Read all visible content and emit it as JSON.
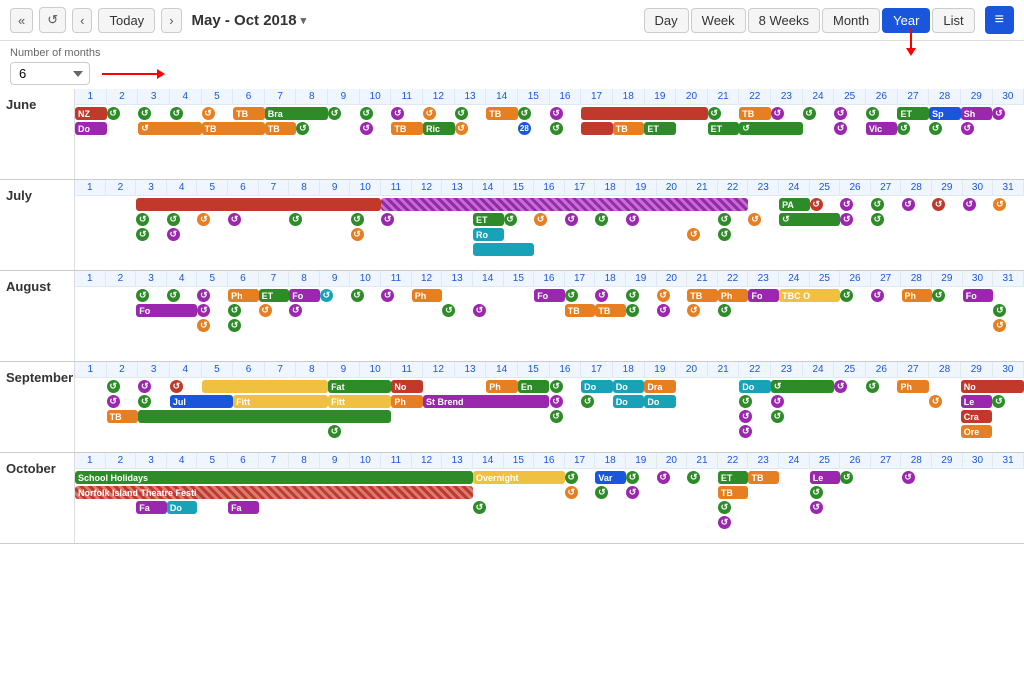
{
  "toolbar": {
    "back_back_label": "«",
    "refresh_label": "↺",
    "back_label": "‹",
    "today_label": "Today",
    "forward_label": "›",
    "date_range": "May - Oct 2018",
    "chevron": "∨",
    "views": [
      "Day",
      "Week",
      "8 Weeks",
      "Month",
      "Year",
      "List"
    ],
    "active_view": "Year",
    "menu_label": "≡"
  },
  "controls": {
    "months_label": "Number of months",
    "months_value": "6"
  },
  "months": [
    {
      "name": "June",
      "days": 30,
      "start_offset": 0
    },
    {
      "name": "July",
      "days": 31,
      "start_offset": 0
    },
    {
      "name": "August",
      "days": 31,
      "start_offset": 0
    },
    {
      "name": "September",
      "days": 30,
      "start_offset": 0
    },
    {
      "name": "October",
      "days": 31,
      "start_offset": 0
    }
  ],
  "june_events": [
    {
      "label": "NZ",
      "color": "#c0392b",
      "col_start": 1,
      "col_span": 1
    },
    {
      "label": "Br",
      "color": "#2d8c27",
      "col_start": 3,
      "col_span": 2
    },
    {
      "label": "TB",
      "color": "#e67e22",
      "col_start": 6,
      "col_span": 1
    },
    {
      "label": "Do",
      "color": "#9b27af",
      "col_start": 1,
      "col_span": 1
    },
    {
      "label": "TB",
      "color": "#e67e22",
      "col_start": 7,
      "col_span": 2
    },
    {
      "label": "",
      "color": "#c0392b",
      "col_start": 15,
      "col_span": 7
    },
    {
      "label": "TB",
      "color": "#e67e22",
      "col_start": 23,
      "col_span": 1
    },
    {
      "label": "ET",
      "color": "#2d8c27",
      "col_start": 26,
      "col_span": 1
    },
    {
      "label": "Sp",
      "color": "#1a56db",
      "col_start": 28,
      "col_span": 1
    },
    {
      "label": "Sh",
      "color": "#9b27af",
      "col_start": 29,
      "col_span": 1
    }
  ],
  "july_events": [
    {
      "label": "",
      "color": "#c0392b",
      "col_start": 3,
      "col_span": 8,
      "striped": false
    },
    {
      "label": "",
      "color": "#9b27af",
      "col_start": 11,
      "col_span": 12,
      "striped": true
    },
    {
      "label": "PA",
      "color": "#2d8c27",
      "col_start": 24,
      "col_span": 1
    },
    {
      "label": "ET",
      "color": "#2d8c27",
      "col_start": 14,
      "col_span": 1
    },
    {
      "label": "Ro",
      "color": "#17a2b8",
      "col_start": 14,
      "col_span": 1
    }
  ],
  "august_events": [
    {
      "label": "ET",
      "color": "#2d8c27",
      "col_start": 6,
      "col_span": 1
    },
    {
      "label": "Fo",
      "color": "#9b27af",
      "col_start": 7,
      "col_span": 1
    },
    {
      "label": "Ph",
      "color": "#e67e22",
      "col_start": 8,
      "col_span": 1
    },
    {
      "label": "Fo",
      "color": "#9b27af",
      "col_start": 3,
      "col_span": 2
    },
    {
      "label": "TB",
      "color": "#e67e22",
      "col_start": 18,
      "col_span": 1
    },
    {
      "label": "Ph",
      "color": "#e67e22",
      "col_start": 21,
      "col_span": 1
    },
    {
      "label": "TBC",
      "color": "#f0c040",
      "col_start": 23,
      "col_span": 2
    },
    {
      "label": "Fo",
      "color": "#9b27af",
      "col_start": 28,
      "col_span": 1
    }
  ],
  "september_events": [
    {
      "label": "Fat",
      "color": "#2d8c27",
      "col_start": 9,
      "col_span": 2
    },
    {
      "label": "No",
      "color": "#c0392b",
      "col_start": 11,
      "col_span": 1
    },
    {
      "label": "Ph",
      "color": "#e67e22",
      "col_start": 14,
      "col_span": 1
    },
    {
      "label": "Fit",
      "color": "#f0c040",
      "col_start": 6,
      "col_span": 3
    },
    {
      "label": "Jul",
      "color": "#1a56db",
      "col_start": 4,
      "col_span": 2
    },
    {
      "label": "St Brend",
      "color": "#9b27af",
      "col_start": 12,
      "col_span": 4
    },
    {
      "label": "En",
      "color": "#2d8c27",
      "col_start": 15,
      "col_span": 1
    },
    {
      "label": "Do",
      "color": "#17a2b8",
      "col_start": 17,
      "col_span": 1
    },
    {
      "label": "Dra",
      "color": "#e67e22",
      "col_start": 20,
      "col_span": 1
    },
    {
      "label": "Do",
      "color": "#17a2b8",
      "col_start": 22,
      "col_span": 1
    },
    {
      "label": "Ph",
      "color": "#e67e22",
      "col_start": 27,
      "col_span": 1
    },
    {
      "label": "No",
      "color": "#c0392b",
      "col_start": 29,
      "col_span": 2
    },
    {
      "label": "Le",
      "color": "#9b27af",
      "col_start": 29,
      "col_span": 1
    },
    {
      "label": "Cra",
      "color": "#c0392b",
      "col_start": 29,
      "col_span": 1
    },
    {
      "label": "Ore",
      "color": "#e67e22",
      "col_start": 29,
      "col_span": 1
    }
  ],
  "october_events": [
    {
      "label": "School Holidays",
      "color": "#2d8c27",
      "col_start": 1,
      "col_span": 13,
      "striped": false
    },
    {
      "label": "Norfolk Island Theatre Festi",
      "color": "#c0392b",
      "col_start": 1,
      "col_span": 13,
      "striped": false
    },
    {
      "label": "Overnight",
      "color": "#f0c040",
      "col_start": 14,
      "col_span": 3
    },
    {
      "label": "Var",
      "color": "#1a56db",
      "col_start": 18,
      "col_span": 1
    },
    {
      "label": "ET",
      "color": "#2d8c27",
      "col_start": 22,
      "col_span": 1
    },
    {
      "label": "Le",
      "color": "#9b27af",
      "col_start": 25,
      "col_span": 1
    },
    {
      "label": "Fa",
      "color": "#9b27af",
      "col_start": 3,
      "col_span": 1
    },
    {
      "label": "Do",
      "color": "#17a2b8",
      "col_start": 4,
      "col_span": 1
    },
    {
      "label": "Fa",
      "color": "#9b27af",
      "col_start": 6,
      "col_span": 1
    }
  ]
}
